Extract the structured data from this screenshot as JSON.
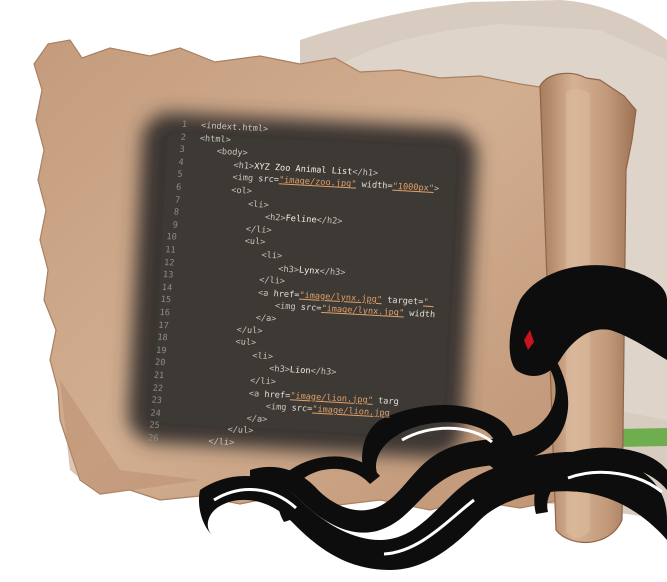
{
  "code": {
    "lines": [
      {
        "n": "1",
        "indent": 0,
        "parts": [
          {
            "t": "tag",
            "v": "<indext.html>"
          }
        ]
      },
      {
        "n": "2",
        "indent": 0,
        "parts": [
          {
            "t": "tag",
            "v": "<html>"
          }
        ]
      },
      {
        "n": "3",
        "indent": 1,
        "parts": [
          {
            "t": "tag",
            "v": "<body>"
          }
        ]
      },
      {
        "n": "4",
        "indent": 2,
        "parts": [
          {
            "t": "tag",
            "v": "<h1>"
          },
          {
            "t": "plain",
            "v": "XYZ Zoo Animal List"
          },
          {
            "t": "tag",
            "v": "</h1>"
          }
        ]
      },
      {
        "n": "5",
        "indent": 2,
        "parts": [
          {
            "t": "tag",
            "v": "<img "
          },
          {
            "t": "attr",
            "v": "src="
          },
          {
            "t": "str",
            "v": "\"image/zoo.jpg\""
          },
          {
            "t": "attr",
            "v": " width="
          },
          {
            "t": "str",
            "v": "\"1000px\""
          },
          {
            "t": "tag",
            "v": ">"
          }
        ]
      },
      {
        "n": "6",
        "indent": 2,
        "parts": [
          {
            "t": "tag",
            "v": "<ol>"
          }
        ]
      },
      {
        "n": "7",
        "indent": 3,
        "parts": [
          {
            "t": "tag",
            "v": "<li>"
          }
        ]
      },
      {
        "n": "8",
        "indent": 4,
        "parts": [
          {
            "t": "tag",
            "v": "<h2>"
          },
          {
            "t": "plain",
            "v": "Feline"
          },
          {
            "t": "tag",
            "v": "</h2>"
          }
        ]
      },
      {
        "n": "9",
        "indent": 3,
        "parts": [
          {
            "t": "tag",
            "v": "</li>"
          }
        ]
      },
      {
        "n": "10",
        "indent": 3,
        "parts": [
          {
            "t": "tag",
            "v": "<ul>"
          }
        ]
      },
      {
        "n": "11",
        "indent": 4,
        "parts": [
          {
            "t": "tag",
            "v": "<li>"
          }
        ]
      },
      {
        "n": "12",
        "indent": 5,
        "parts": [
          {
            "t": "tag",
            "v": "<h3>"
          },
          {
            "t": "plain",
            "v": "Lynx"
          },
          {
            "t": "tag",
            "v": "</h3>"
          }
        ]
      },
      {
        "n": "13",
        "indent": 4,
        "parts": [
          {
            "t": "tag",
            "v": "</li>"
          }
        ]
      },
      {
        "n": "14",
        "indent": 4,
        "parts": [
          {
            "t": "tag",
            "v": "<a "
          },
          {
            "t": "attr",
            "v": "href="
          },
          {
            "t": "str",
            "v": "\"image/lynx.jpg\""
          },
          {
            "t": "attr",
            "v": " target="
          },
          {
            "t": "str",
            "v": "\"_"
          }
        ]
      },
      {
        "n": "15",
        "indent": 5,
        "parts": [
          {
            "t": "tag",
            "v": "<img "
          },
          {
            "t": "attr",
            "v": "src="
          },
          {
            "t": "str",
            "v": "\"image/lynx.jpg\""
          },
          {
            "t": "attr",
            "v": " width"
          }
        ]
      },
      {
        "n": "16",
        "indent": 4,
        "parts": [
          {
            "t": "tag",
            "v": "</a>"
          }
        ]
      },
      {
        "n": "17",
        "indent": 3,
        "parts": [
          {
            "t": "tag",
            "v": "</ul>"
          }
        ]
      },
      {
        "n": "18",
        "indent": 3,
        "parts": [
          {
            "t": "tag",
            "v": "<ul>"
          }
        ]
      },
      {
        "n": "19",
        "indent": 4,
        "parts": [
          {
            "t": "tag",
            "v": "<li>"
          }
        ]
      },
      {
        "n": "20",
        "indent": 5,
        "parts": [
          {
            "t": "tag",
            "v": "<h3>"
          },
          {
            "t": "plain",
            "v": "Lion"
          },
          {
            "t": "tag",
            "v": "</h3>"
          }
        ]
      },
      {
        "n": "21",
        "indent": 4,
        "parts": [
          {
            "t": "tag",
            "v": "</li>"
          }
        ]
      },
      {
        "n": "22",
        "indent": 4,
        "parts": [
          {
            "t": "tag",
            "v": "<a "
          },
          {
            "t": "attr",
            "v": "href="
          },
          {
            "t": "str",
            "v": "\"image/lion.jpg\""
          },
          {
            "t": "attr",
            "v": " targ"
          }
        ]
      },
      {
        "n": "23",
        "indent": 5,
        "parts": [
          {
            "t": "tag",
            "v": "<img "
          },
          {
            "t": "attr",
            "v": "src="
          },
          {
            "t": "str",
            "v": "\"image/lion.jpg"
          }
        ]
      },
      {
        "n": "24",
        "indent": 4,
        "parts": [
          {
            "t": "tag",
            "v": "</a>"
          }
        ]
      },
      {
        "n": "25",
        "indent": 3,
        "parts": [
          {
            "t": "tag",
            "v": "</ul>"
          }
        ]
      },
      {
        "n": "26",
        "indent": 2,
        "parts": [
          {
            "t": "tag",
            "v": "</li>"
          }
        ]
      }
    ]
  },
  "colors": {
    "parchment": "#c9a283",
    "parchment_light": "#d8b496",
    "parchment_dark": "#b48865",
    "backdrop": "#d9cdc2",
    "code_bg": "#3a3631",
    "snake": "#0d0d0d",
    "snake_eye": "#c8141c",
    "grass": "#6fae4e"
  },
  "icons": [
    "snake-icon",
    "scroll-icon"
  ]
}
